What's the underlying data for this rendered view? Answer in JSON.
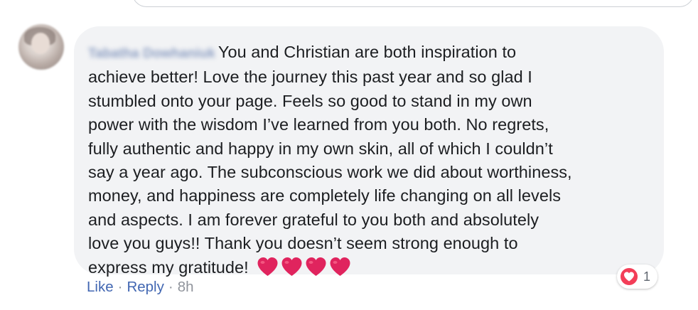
{
  "comment": {
    "author": "Tabatha Dowhaniuk",
    "lines": [
      "You and Christian are both inspiration to",
      "achieve better! Love the journey this past year and so glad I",
      "stumbled onto your page. Feels so good to stand in my own",
      "power with the wisdom I’ve learned from you both. No regrets,",
      "fully authentic and happy in my own skin, all of which I couldn’t",
      "say a year ago. The subconscious work we did about worthiness,",
      "money, and happiness are completely life changing on all levels",
      "and aspects. I am forever grateful to you both and absolutely",
      "love you guys!! Thank you doesn’t seem strong enough to",
      "express my gratitude!"
    ],
    "emoji": [
      "red-heart",
      "red-heart",
      "red-heart",
      "red-heart"
    ]
  },
  "reactions": {
    "icon": "heart-reaction-icon",
    "count": "1",
    "color": "#f33e58"
  },
  "actions": {
    "like": "Like",
    "separator": "·",
    "reply": "Reply",
    "time": "8h"
  },
  "colors": {
    "bubble": "#f2f3f5",
    "text": "#1c1e21",
    "link": "#4267b2",
    "meta": "#90949c",
    "heart": "#e0245e"
  }
}
